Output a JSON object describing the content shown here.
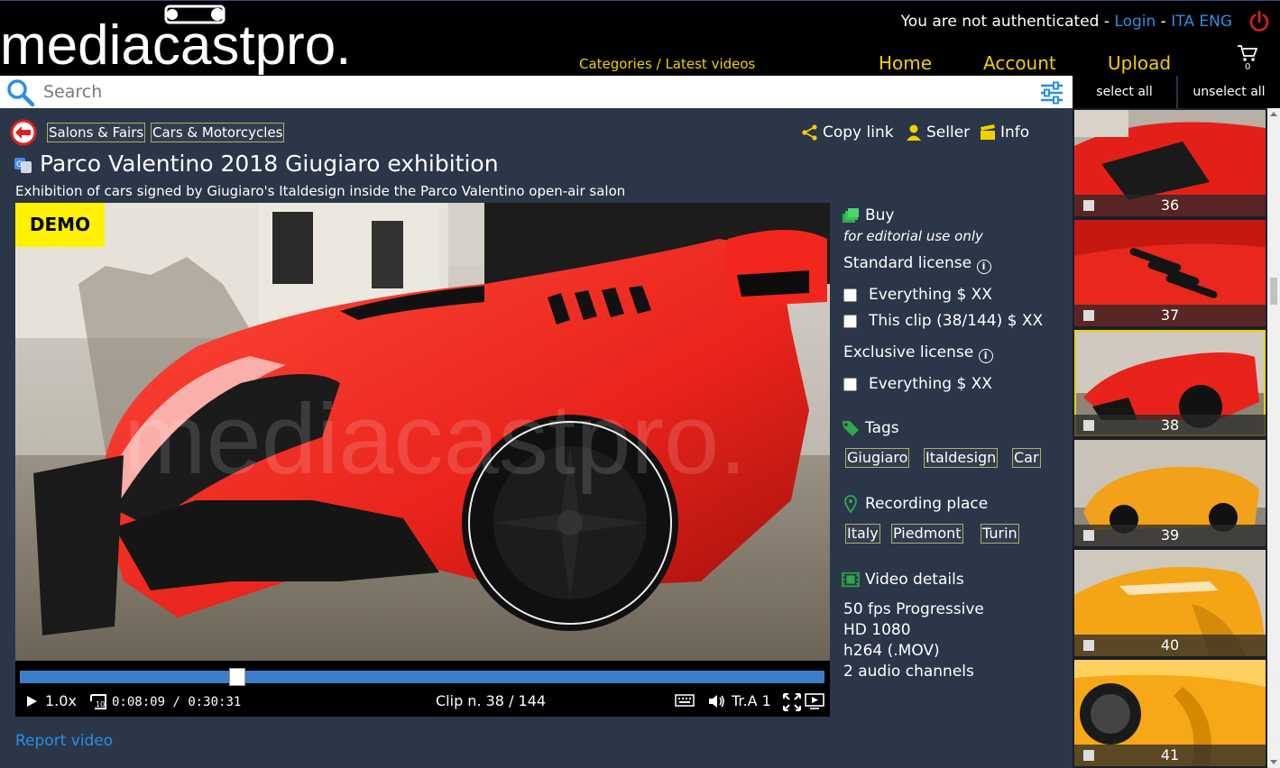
{
  "header": {
    "logo_text": "mediacastpro.",
    "auth_text": "You are not authenticated - ",
    "login_label": "Login",
    "auth_sep": " - ",
    "lang_ita": "ITA",
    "lang_eng": "ENG",
    "categories_label": "Categories / Latest videos",
    "nav": {
      "home": "Home",
      "account": "Account",
      "upload": "Upload"
    },
    "cart_count": "0"
  },
  "search": {
    "placeholder": "Search"
  },
  "selection": {
    "select_all": "select all",
    "unselect_all": "unselect all"
  },
  "breadcrumbs": [
    "Salons & Fairs",
    "Cars & Motorcycles"
  ],
  "actions": {
    "copy_link": "Copy link",
    "seller": "Seller",
    "info": "Info"
  },
  "video": {
    "title": "Parco Valentino 2018 Giugiaro exhibition",
    "subtitle": "Exhibition of cars signed by Giugiaro's Italdesign inside the Parco Valentino open-air salon",
    "demo_label": "DEMO",
    "speed": "1.0x",
    "time_current": "0:08:09",
    "time_sep": " / ",
    "time_total": "0:30:31",
    "clip_label": "Clip n. 38 / 144",
    "track_label": "Tr.A 1",
    "progress": 0.27
  },
  "report_label": "Report video",
  "buy": {
    "title": "Buy",
    "note": "for editorial use only",
    "standard_label": "Standard license",
    "standard_options": [
      "Everything $ XX",
      "This clip (38/144) $ XX"
    ],
    "exclusive_label": "Exclusive license",
    "exclusive_options": [
      "Everything $ XX"
    ]
  },
  "tags": {
    "title": "Tags",
    "items": [
      "Giugiaro",
      "Italdesign",
      "Car"
    ]
  },
  "place": {
    "title": "Recording place",
    "items": [
      "Italy",
      "Piedmont",
      "Turin"
    ]
  },
  "details": {
    "title": "Video details",
    "items": [
      "50 fps Progressive",
      "HD 1080",
      "h264 (.MOV)",
      "2 audio channels"
    ]
  },
  "thumbnails": [
    {
      "num": "36",
      "color": "red"
    },
    {
      "num": "37",
      "color": "red"
    },
    {
      "num": "38",
      "color": "red",
      "selected": true
    },
    {
      "num": "39",
      "color": "orange"
    },
    {
      "num": "40",
      "color": "orange"
    },
    {
      "num": "41",
      "color": "orange"
    }
  ],
  "colors": {
    "accent_yellow": "#f1d000",
    "link_blue": "#2a8fe6",
    "bg_main": "#2b3649",
    "progress_blue": "#3d7dc8"
  }
}
